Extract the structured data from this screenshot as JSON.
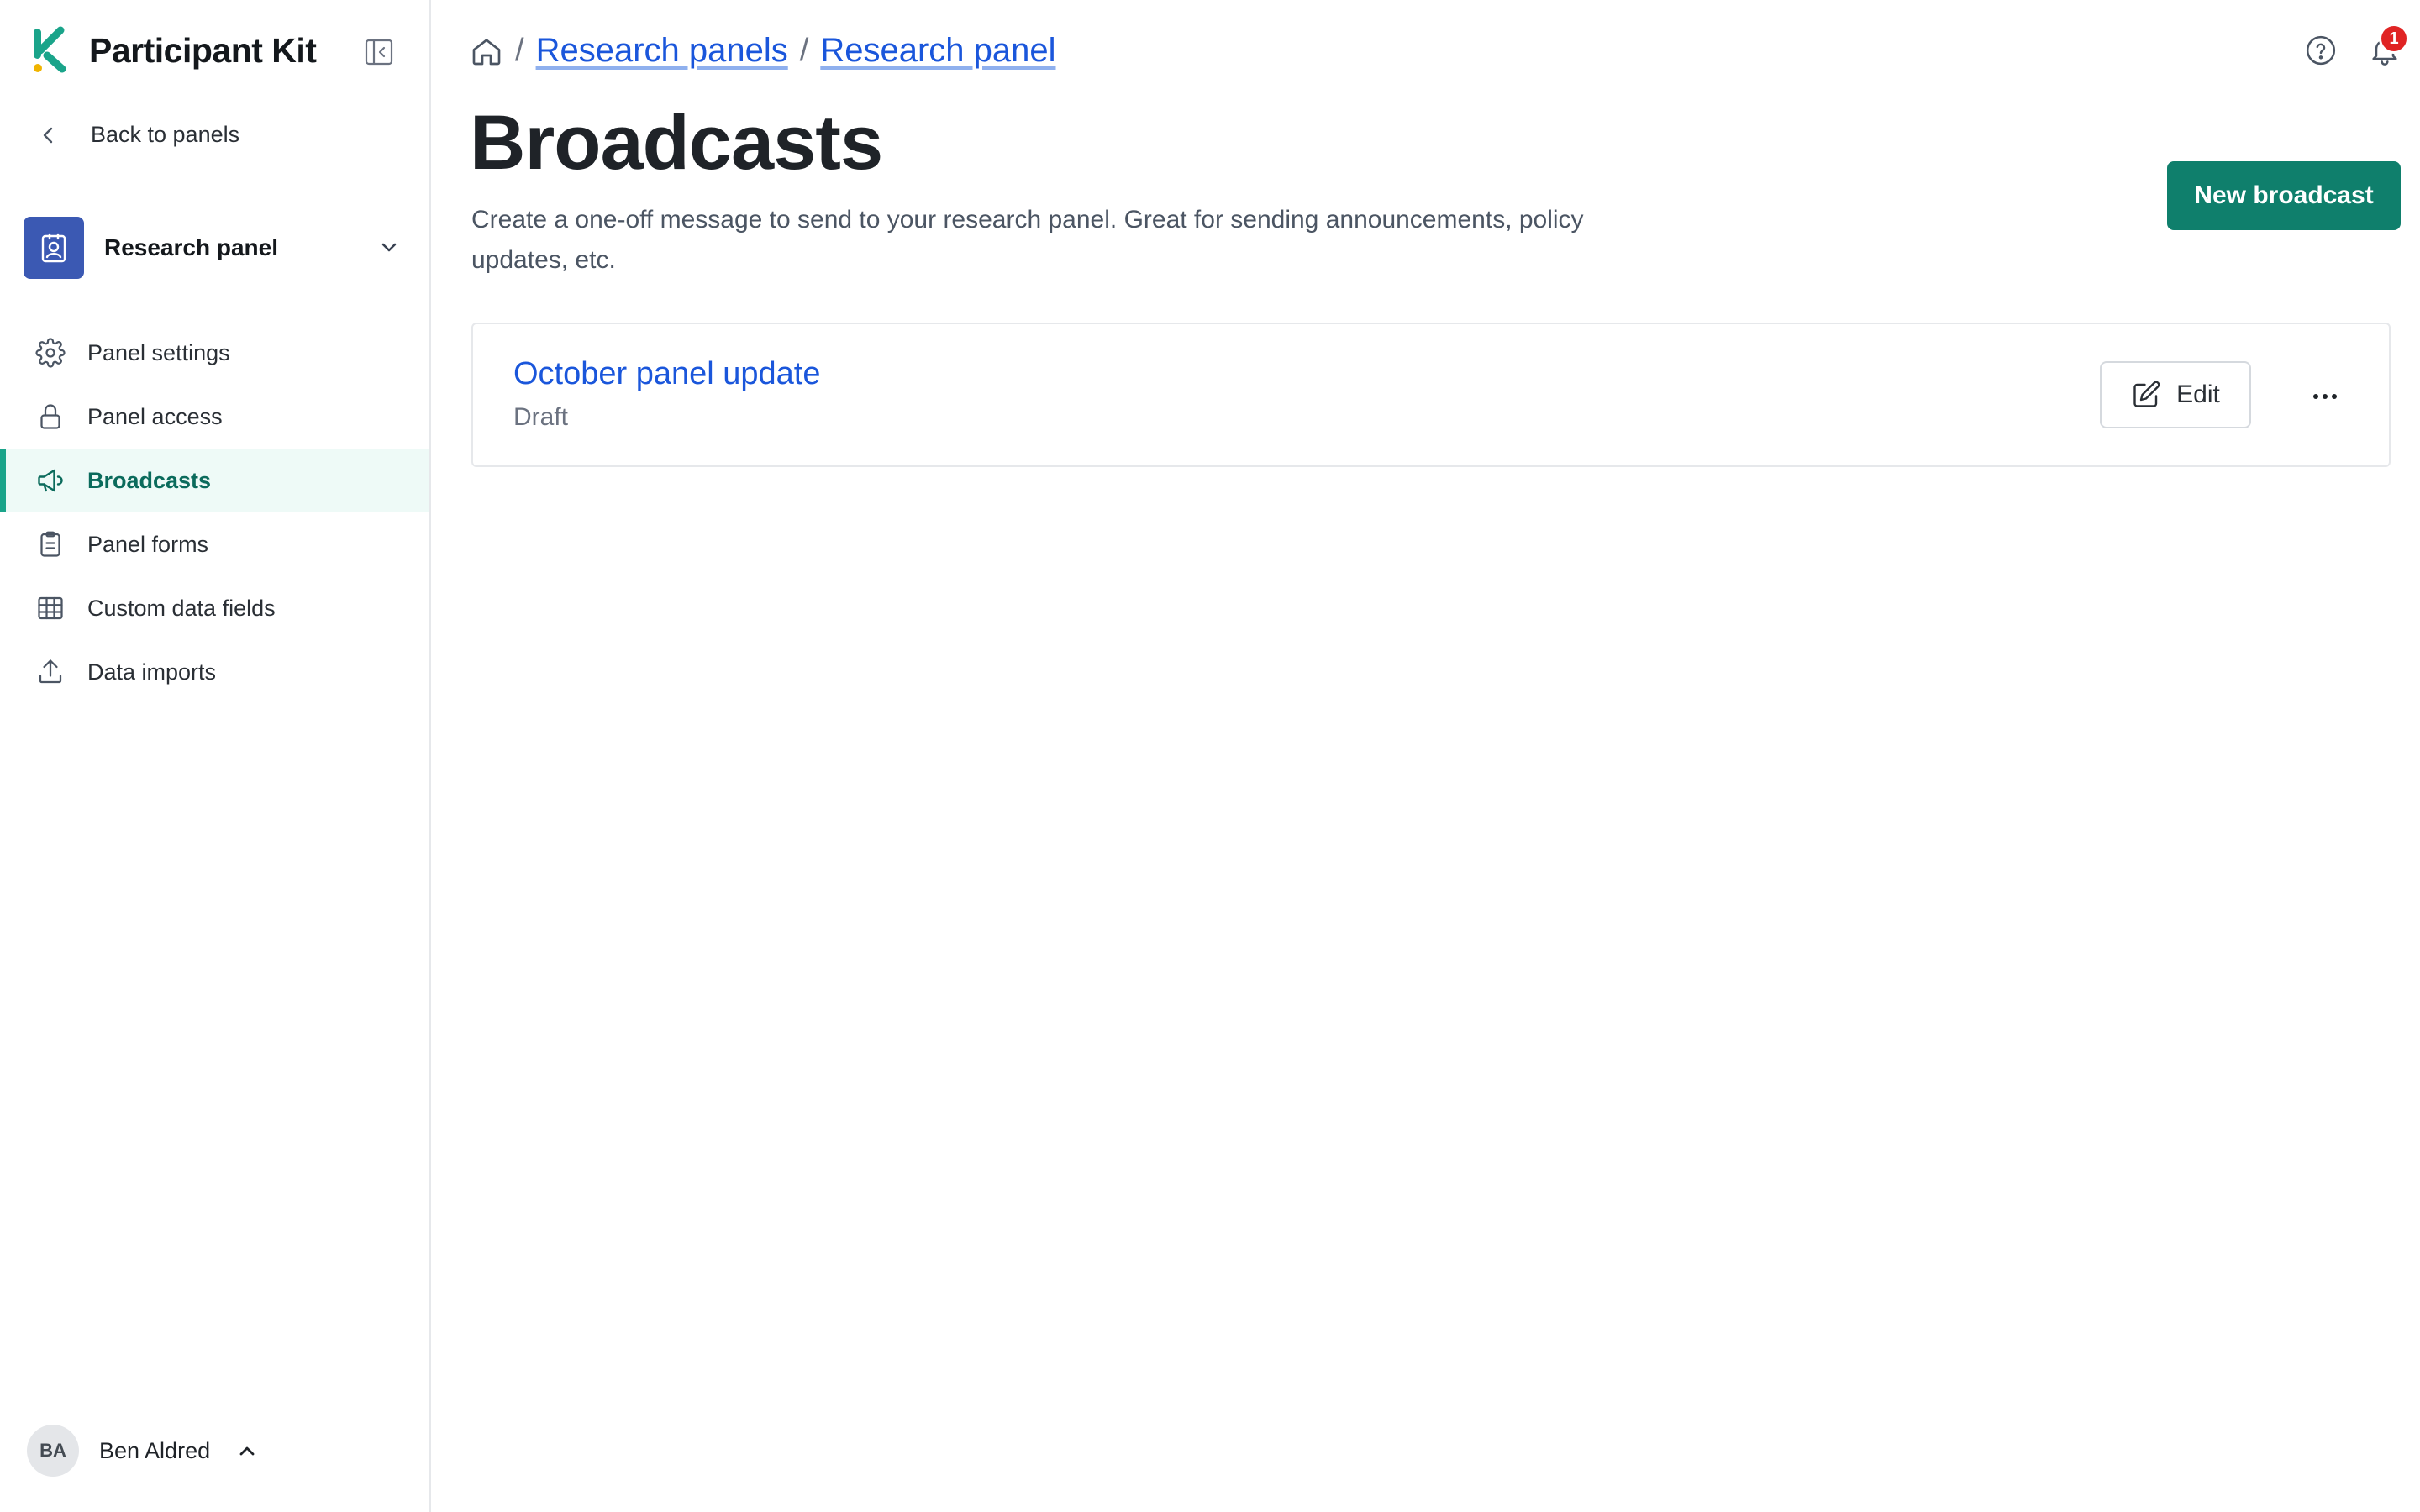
{
  "brand": {
    "name": "Participant Kit",
    "accent": "#1aa48a"
  },
  "sidebar": {
    "back_label": "Back to panels",
    "panel_switcher": {
      "label": "Research panel"
    },
    "items": [
      {
        "label": "Panel settings",
        "icon": "gear-icon"
      },
      {
        "label": "Panel access",
        "icon": "lock-icon"
      },
      {
        "label": "Broadcasts",
        "icon": "megaphone-icon",
        "active": true
      },
      {
        "label": "Panel forms",
        "icon": "clipboard-icon"
      },
      {
        "label": "Custom data fields",
        "icon": "table-icon"
      },
      {
        "label": "Data imports",
        "icon": "upload-icon"
      }
    ],
    "user": {
      "initials": "BA",
      "name": "Ben Aldred"
    }
  },
  "header": {
    "breadcrumb": [
      "Research panels",
      "Research panel"
    ],
    "notifications_count": "1"
  },
  "main": {
    "title": "Broadcasts",
    "description": "Create a one-off message to send to your research panel. Great for sending announcements, policy updates, etc.",
    "new_button_label": "New broadcast",
    "broadcasts": [
      {
        "title": "October panel update",
        "status": "Draft",
        "edit_label": "Edit"
      }
    ]
  },
  "colors": {
    "primary": "#0f7f6c",
    "link": "#1a56db",
    "panel_avatar": "#3b59b3",
    "badge": "#e02424"
  }
}
